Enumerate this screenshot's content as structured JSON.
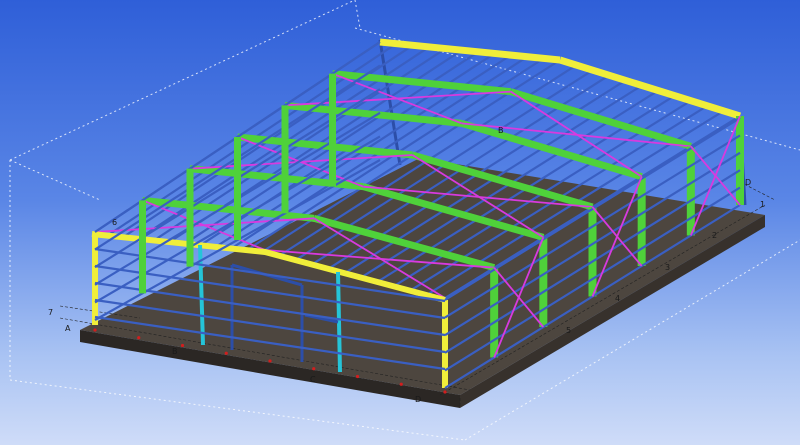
{
  "viewport": {
    "background_top": "#2f5fd8",
    "background_bottom": "#cfdcf8"
  },
  "colors": {
    "column_blue": "#2c4ea8",
    "purlin_blue": "#3a5fc2",
    "rafter_green": "#4fd13a",
    "end_yellow": "#f0ee3a",
    "brace_magenta": "#d83adf",
    "cyan_column": "#25c4d8",
    "slab": "#4d463f",
    "slab_edge": "#2b2724",
    "grid_red": "#d21e1e"
  },
  "grid_labels": {
    "a": "A",
    "b": "B",
    "c": "C",
    "d": "D",
    "one": "1",
    "two": "2",
    "three": "3",
    "four": "4",
    "five": "5",
    "six": "6",
    "seven": "7"
  }
}
